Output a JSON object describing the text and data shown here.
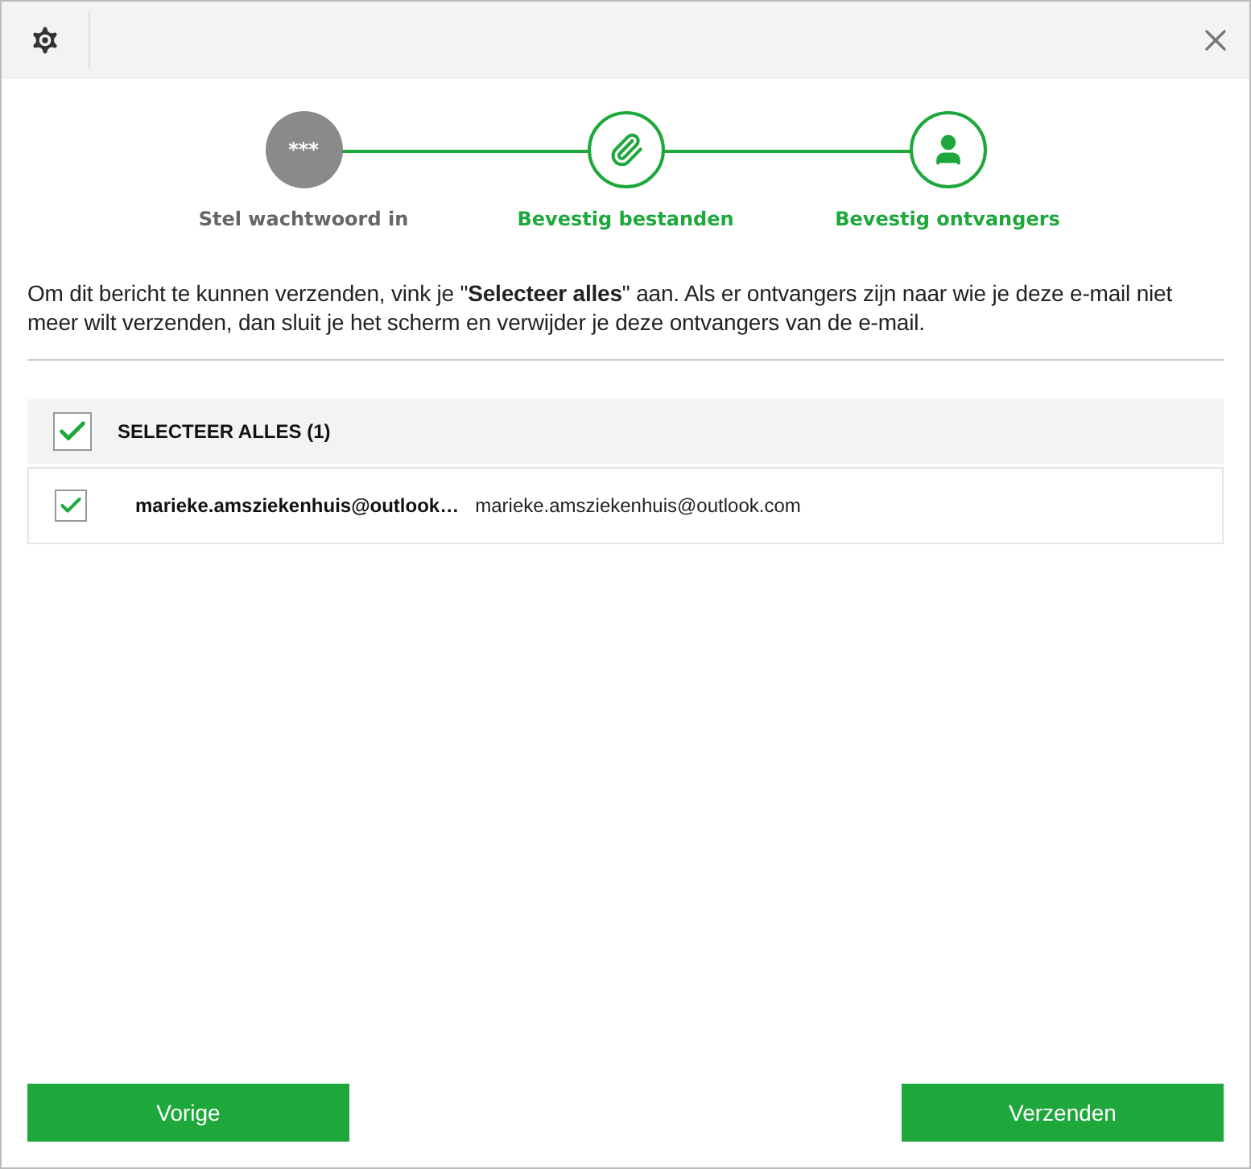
{
  "steps": [
    {
      "kind": "password",
      "label": "Stel wachtwoord in",
      "symbol": "***",
      "active": false
    },
    {
      "kind": "attachment",
      "label": "Bevestig bestanden",
      "active": true
    },
    {
      "kind": "recipient",
      "label": "Bevestig ontvangers",
      "active": true
    }
  ],
  "intro": "Om dit bericht te kunnen verzenden, vink je \"**Selecteer alles**\" aan. Als er ontvangers zijn naar wie je deze e-mail niet meer wilt verzenden, dan sluit je het scherm en verwijder je deze ontvangers van de e-mail.",
  "select_all": {
    "label": "SELECTEER ALLES (1)",
    "checked": true
  },
  "recipients": [
    {
      "name": "marieke.amsziekenhuis@outlook…",
      "email": "marieke.amsziekenhuis@outlook.com",
      "checked": true
    }
  ],
  "buttons": {
    "back": "Vorige",
    "send": "Verzenden"
  }
}
